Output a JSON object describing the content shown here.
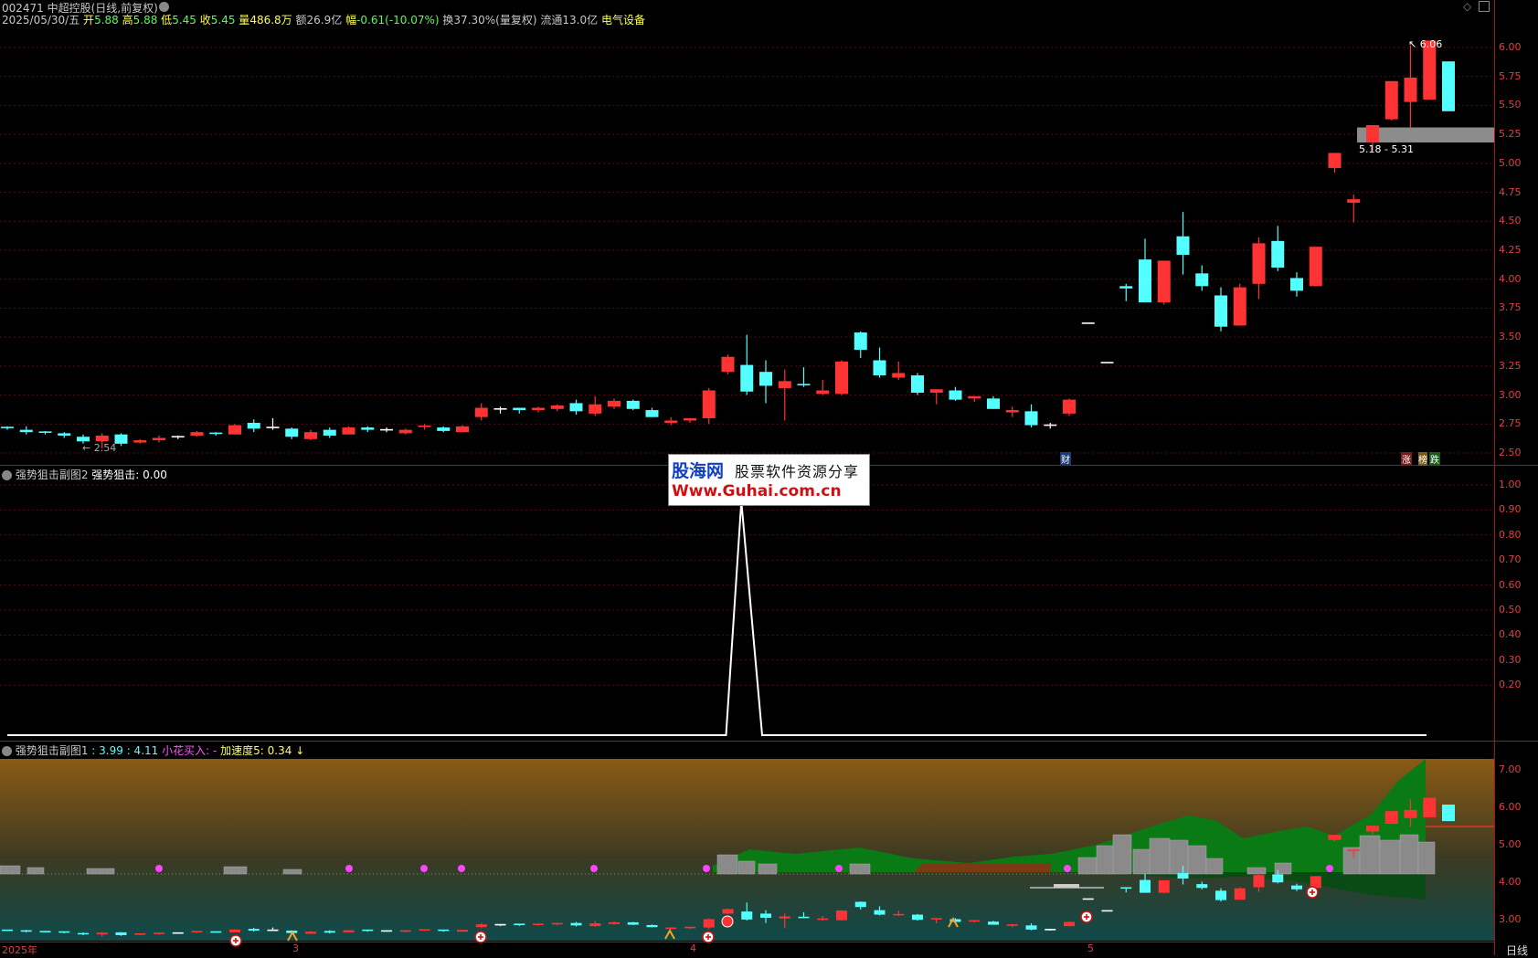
{
  "header": {
    "title": "002471 中超控股(日线,前复权)",
    "date": "2025/05/30/五",
    "open_label": "开",
    "open": "5.88",
    "high_label": "高",
    "high": "5.88",
    "low_label": "低",
    "low": "5.45",
    "close_label": "收",
    "close": "5.45",
    "vol_label": "量",
    "vol": "486.8万",
    "amt_label": "额",
    "amt": "26.9亿",
    "chg_label": "幅",
    "chg": "-0.61(-10.07%)",
    "turnover": "换37.30%(量复权)",
    "float": "流通13.0亿",
    "sector": "电气设备"
  },
  "main_chart": {
    "axis_ticks": [
      "6.00",
      "5.75",
      "5.50",
      "5.25",
      "5.00",
      "4.75",
      "4.50",
      "4.25",
      "4.00",
      "3.75",
      "3.50",
      "3.25",
      "3.00",
      "2.75",
      "2.50"
    ],
    "max_label": "6.06",
    "min_label": "2.54",
    "zone_label": "5.18 - 5.31",
    "badge_cai": "财",
    "badge_zhang": "涨",
    "badge_die": "跌",
    "badge_rank": "榜"
  },
  "sub2": {
    "title": "强势狙击副图2",
    "value_label": "强势狙击:",
    "value": "0.00",
    "axis_ticks": [
      "1.00",
      "0.90",
      "0.80",
      "0.70",
      "0.60",
      "0.50",
      "0.40",
      "0.30",
      "0.20"
    ]
  },
  "sub1": {
    "title": "强势狙击副图1",
    "v1": ": 3.99",
    "v2": ": 4.11",
    "buy_label": "小花买入:",
    "buy_value": "-",
    "accel_label": "加速度5:",
    "accel_value": "0.34",
    "accel_arrow": "↓",
    "axis_ticks": [
      "7.00",
      "6.00",
      "5.00",
      "4.00",
      "3.00"
    ]
  },
  "bottom": {
    "year_label": "2025年",
    "m3": "3",
    "m4": "4",
    "m5": "5",
    "period": "日线"
  },
  "watermark": {
    "brand": "股海网",
    "slogan": "股票软件资源分享",
    "url": "Www.Guhai.com.cn"
  },
  "colors": {
    "up": "#ff3333",
    "down": "#54ffff",
    "grid": "#5a0a0a",
    "axis": "#e04040"
  },
  "chart_data": {
    "type": "candlestick",
    "note_axis": "price",
    "ylim": [
      2.45,
      6.15
    ],
    "candles": [
      [
        2.72,
        2.73,
        2.7,
        2.71
      ],
      [
        2.7,
        2.73,
        2.66,
        2.68
      ],
      [
        2.68,
        2.69,
        2.66,
        2.67
      ],
      [
        2.67,
        2.68,
        2.63,
        2.65
      ],
      [
        2.64,
        2.66,
        2.58,
        2.6
      ],
      [
        2.6,
        2.67,
        2.54,
        2.65
      ],
      [
        2.66,
        2.67,
        2.56,
        2.58
      ],
      [
        2.59,
        2.62,
        2.58,
        2.61
      ],
      [
        2.61,
        2.65,
        2.59,
        2.63
      ],
      [
        2.64,
        2.65,
        2.62,
        2.64
      ],
      [
        2.65,
        2.69,
        2.64,
        2.68
      ],
      [
        2.67,
        2.68,
        2.65,
        2.66
      ],
      [
        2.66,
        2.75,
        2.66,
        2.74
      ],
      [
        2.76,
        2.79,
        2.68,
        2.71
      ],
      [
        2.72,
        2.8,
        2.7,
        2.72
      ],
      [
        2.71,
        2.72,
        2.62,
        2.64
      ],
      [
        2.62,
        2.7,
        2.61,
        2.68
      ],
      [
        2.7,
        2.72,
        2.63,
        2.65
      ],
      [
        2.66,
        2.73,
        2.66,
        2.72
      ],
      [
        2.72,
        2.73,
        2.68,
        2.7
      ],
      [
        2.7,
        2.72,
        2.68,
        2.7
      ],
      [
        2.67,
        2.71,
        2.66,
        2.7
      ],
      [
        2.72,
        2.75,
        2.7,
        2.73
      ],
      [
        2.72,
        2.73,
        2.68,
        2.69
      ],
      [
        2.68,
        2.74,
        2.68,
        2.73
      ],
      [
        2.81,
        2.93,
        2.78,
        2.89
      ],
      [
        2.88,
        2.9,
        2.84,
        2.88
      ],
      [
        2.89,
        2.89,
        2.84,
        2.87
      ],
      [
        2.87,
        2.9,
        2.85,
        2.89
      ],
      [
        2.88,
        2.92,
        2.86,
        2.91
      ],
      [
        2.93,
        2.96,
        2.83,
        2.86
      ],
      [
        2.84,
        2.99,
        2.82,
        2.92
      ],
      [
        2.9,
        2.97,
        2.88,
        2.95
      ],
      [
        2.95,
        2.96,
        2.87,
        2.88
      ],
      [
        2.87,
        2.89,
        2.81,
        2.81
      ],
      [
        2.76,
        2.81,
        2.74,
        2.78
      ],
      [
        2.78,
        2.8,
        2.76,
        2.8
      ],
      [
        2.8,
        3.06,
        2.75,
        3.04
      ],
      [
        3.2,
        3.35,
        3.18,
        3.33
      ],
      [
        3.26,
        3.52,
        3.0,
        3.03
      ],
      [
        3.2,
        3.3,
        2.93,
        3.08
      ],
      [
        3.06,
        3.22,
        2.78,
        3.12
      ],
      [
        3.09,
        3.24,
        3.07,
        3.08
      ],
      [
        3.01,
        3.13,
        3.0,
        3.04
      ],
      [
        3.01,
        3.3,
        3.0,
        3.29
      ],
      [
        3.54,
        3.55,
        3.32,
        3.39
      ],
      [
        3.3,
        3.41,
        3.15,
        3.17
      ],
      [
        3.15,
        3.29,
        3.13,
        3.19
      ],
      [
        3.17,
        3.19,
        3.0,
        3.02
      ],
      [
        3.02,
        3.05,
        2.92,
        3.05
      ],
      [
        3.04,
        3.07,
        2.95,
        2.96
      ],
      [
        2.97,
        2.99,
        2.94,
        2.99
      ],
      [
        2.97,
        2.99,
        2.88,
        2.88
      ],
      [
        2.85,
        2.9,
        2.81,
        2.87
      ],
      [
        2.86,
        2.92,
        2.72,
        2.74
      ],
      [
        2.74,
        2.76,
        2.71,
        2.74
      ],
      [
        2.84,
        2.97,
        2.82,
        2.96
      ],
      [
        3.62,
        3.62,
        3.62,
        3.62
      ],
      [
        3.28,
        3.28,
        3.28,
        3.28
      ],
      [
        3.94,
        3.96,
        3.81,
        3.92
      ],
      [
        4.17,
        4.35,
        3.8,
        3.8
      ],
      [
        3.8,
        4.16,
        3.78,
        4.16
      ],
      [
        4.37,
        4.58,
        4.04,
        4.21
      ],
      [
        4.05,
        4.12,
        3.9,
        3.94
      ],
      [
        3.86,
        3.93,
        3.55,
        3.59
      ],
      [
        3.6,
        3.96,
        3.6,
        3.93
      ],
      [
        3.96,
        4.36,
        3.83,
        4.31
      ],
      [
        4.33,
        4.46,
        4.07,
        4.1
      ],
      [
        4.01,
        4.06,
        3.85,
        3.9
      ],
      [
        3.94,
        4.28,
        3.94,
        4.28
      ],
      [
        4.96,
        5.09,
        4.92,
        5.09
      ],
      [
        4.66,
        4.73,
        4.49,
        4.69
      ],
      [
        5.18,
        5.33,
        5.11,
        5.33
      ],
      [
        5.38,
        5.71,
        5.37,
        5.71
      ],
      [
        5.53,
        6.02,
        5.31,
        5.74
      ],
      [
        5.55,
        6.06,
        5.55,
        6.06
      ],
      [
        5.88,
        5.88,
        5.45,
        5.45
      ]
    ],
    "sub2_line": {
      "baseline": 0,
      "peak_index": 39,
      "peak_value": 1.0,
      "ylim": [
        0,
        1.0
      ]
    },
    "sub1_candles_ylim": [
      2.6,
      7.4
    ]
  }
}
